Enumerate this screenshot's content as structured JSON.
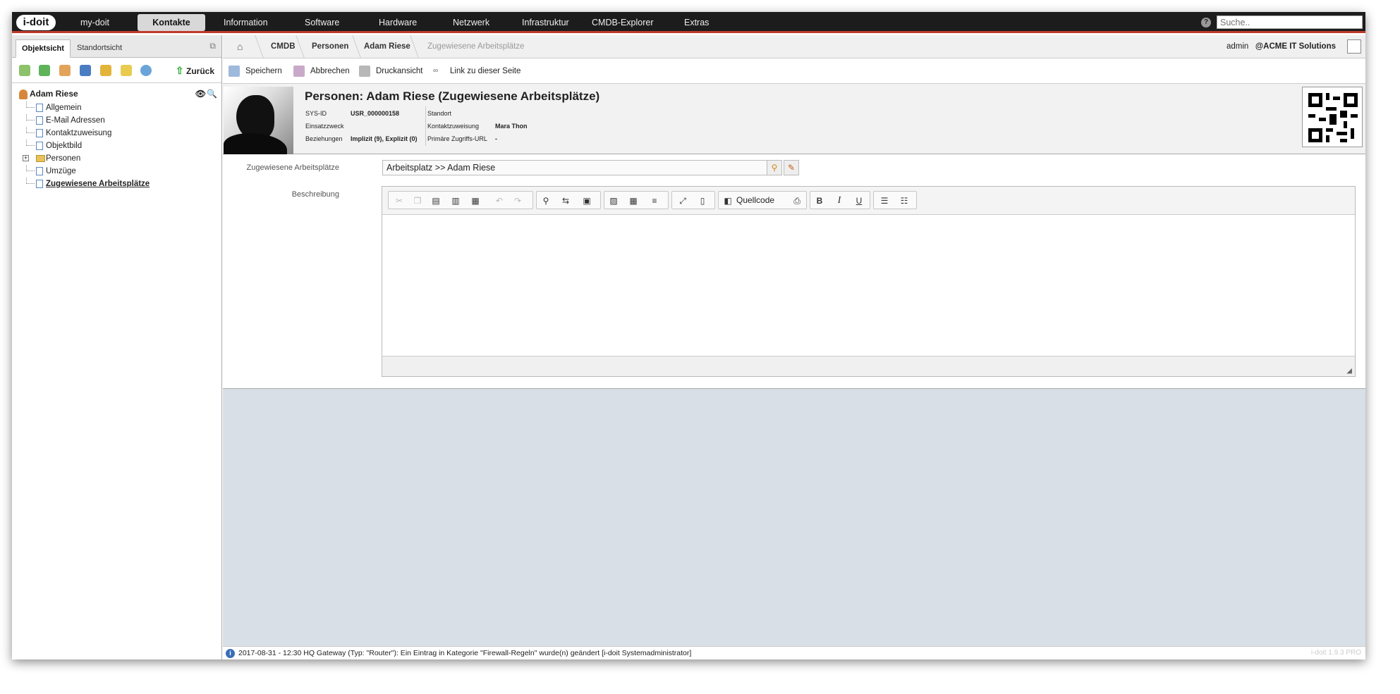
{
  "app": {
    "logo": "i-doit"
  },
  "topnav": {
    "items": [
      "my-doit",
      "Kontakte",
      "Information",
      "Software",
      "Hardware",
      "Netzwerk",
      "Infrastruktur",
      "CMDB-Explorer",
      "Extras"
    ],
    "active": "Kontakte",
    "search_placeholder": "Suche.."
  },
  "left": {
    "tabs": [
      "Objektsicht",
      "Standortsicht"
    ],
    "back_label": "Zurück",
    "tree": {
      "root": "Adam Riese",
      "items": [
        "Allgemein",
        "E-Mail Adressen",
        "Kontaktzuweisung",
        "Objektbild",
        "Personen",
        "Umzüge",
        "Zugewiesene Arbeitsplätze"
      ],
      "selected": "Zugewiesene Arbeitsplätze"
    }
  },
  "breadcrumb": [
    "CMDB",
    "Personen",
    "Adam Riese",
    "Zugewiesene Arbeitsplätze"
  ],
  "user": {
    "name": "admin",
    "tenant": "@ACME IT Solutions"
  },
  "actions": [
    "Speichern",
    "Abbrechen",
    "Druckansicht",
    "Link zu dieser Seite"
  ],
  "object": {
    "title": "Personen: Adam Riese (Zugewiesene Arbeitsplätze)",
    "sysid_label": "SYS-ID",
    "sysid": "USR_000000158",
    "purpose_label": "Einsatzzweck",
    "purpose": "",
    "relations_label": "Beziehungen",
    "relations": "Implizit (9), Explizit (0)",
    "location_label": "Standort",
    "location": "",
    "contact_label": "Kontaktzuweisung",
    "contact": "Mara Thon",
    "url_label": "Primäre Zugriffs-URL",
    "url": "-"
  },
  "form": {
    "assigned_label": "Zugewiesene Arbeitsplätze",
    "assigned_value": "Arbeitsplatz >> Adam Riese",
    "description_label": "Beschreibung",
    "source_label": "Quellcode"
  },
  "status": {
    "message": "2017-08-31 - 12:30 HQ Gateway (Typ: \"Router\"): Ein Eintrag in Kategorie \"Firewall-Regeln\" wurde(n) geändert [i-doit Systemadministrator]",
    "version": "i-doit 1.9.3 PRO"
  },
  "colors": {
    "accent": "#c03a2b",
    "topbar": "#1c1c1c",
    "main_bg": "#d9dfe6"
  }
}
